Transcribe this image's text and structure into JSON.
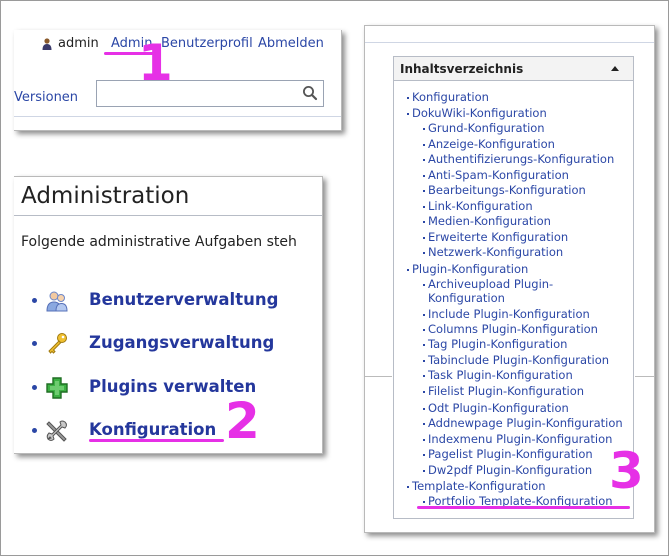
{
  "panel_user": {
    "username": "admin",
    "links": [
      "Admin",
      "Benutzerprofil",
      "Abmelden"
    ],
    "tab_versionen": "Versionen",
    "search_value": "",
    "marker": "1"
  },
  "panel_admin": {
    "title": "Administration",
    "intro": "Folgende administrative Aufgaben steh",
    "items": [
      {
        "label": "Benutzerverwaltung",
        "icon": "users-icon"
      },
      {
        "label": "Zugangsverwaltung",
        "icon": "key-icon"
      },
      {
        "label": "Plugins verwalten",
        "icon": "plugin-plus-icon"
      },
      {
        "label": "Konfiguration",
        "icon": "tools-icon"
      }
    ],
    "marker": "2"
  },
  "panel_toc": {
    "title": "Inhaltsverzeichnis",
    "marker": "3",
    "items": [
      "Konfiguration",
      "DokuWiki-Konfiguration",
      "Grund-Konfiguration",
      "Anzeige-Konfiguration",
      "Authentifizierungs-Konfiguration",
      "Anti-Spam-Konfiguration",
      "Bearbeitungs-Konfiguration",
      "Link-Konfiguration",
      "Medien-Konfiguration",
      "Erweiterte Konfiguration",
      "Netzwerk-Konfiguration",
      "Plugin-Konfiguration",
      "Archiveupload Plugin-",
      "Konfiguration",
      "Include Plugin-Konfiguration",
      "Columns Plugin-Konfiguration",
      "Tag Plugin-Konfiguration",
      "Tabinclude Plugin-Konfiguration",
      "Task Plugin-Konfiguration",
      "Filelist Plugin-Konfiguration",
      "Odt Plugin-Konfiguration",
      "Addnewpage Plugin-Konfiguration",
      "Indexmenu Plugin-Konfiguration",
      "Pagelist Plugin-Konfiguration",
      "Dw2pdf Plugin-Konfiguration",
      "Template-Konfiguration",
      "Portfolio Template-Konfiguration"
    ]
  },
  "colors": {
    "link": "#2b47a6",
    "admin_link": "#24379c",
    "annotation": "#e630e6"
  }
}
